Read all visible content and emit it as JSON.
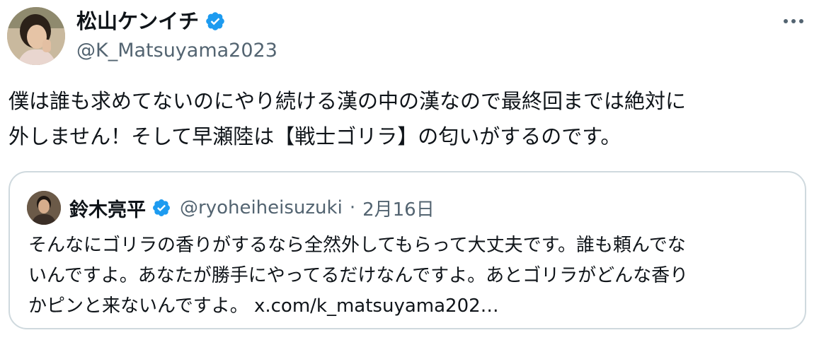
{
  "tweet": {
    "display_name": "松山ケンイチ",
    "handle": "@K_Matsuyama2023",
    "text": "僕は誰も求めてないのにやり続ける漢の中の漢なので最終回までは絶対に\n外しません！そして早瀬陸は【戦士ゴリラ】の匂いがするのです。"
  },
  "quote": {
    "display_name": "鈴木亮平",
    "handle": "@ryoheiheisuzuki",
    "separator": "·",
    "date": "2月16日",
    "text": "そんなにゴリラの香りがするなら全然外してもらって大丈夫です。誰も頼んでな\nいんですよ。あなたが勝手にやってるだけなんですよ。あとゴリラがどんな香り\nかピンと来ないんですよ。 ",
    "link": "x.com/k_matsuyama202…"
  },
  "icons": {
    "verified": "verified-badge-icon",
    "more": "more-options-icon"
  },
  "colors": {
    "verified": "#1d9bf0",
    "secondary_text": "#536471",
    "border": "#cfd9de"
  }
}
